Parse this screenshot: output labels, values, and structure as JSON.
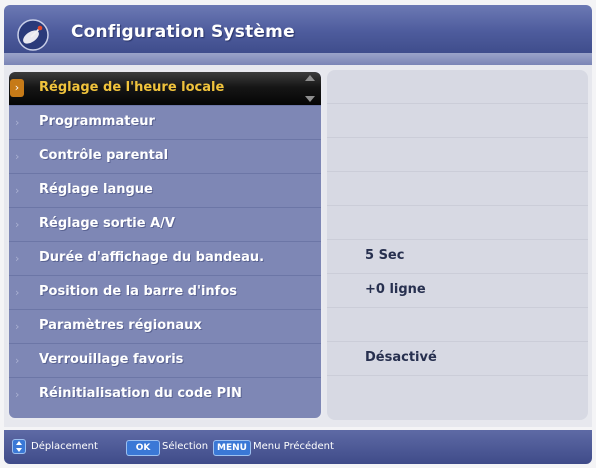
{
  "header": {
    "title": "Configuration Système",
    "logo_icon": "satellite-dish-icon"
  },
  "menu": {
    "selected_index": 0,
    "items": [
      {
        "label": "Réglage de l'heure locale",
        "value": ""
      },
      {
        "label": "Programmateur",
        "value": ""
      },
      {
        "label": "Contrôle parental",
        "value": ""
      },
      {
        "label": "Réglage langue",
        "value": ""
      },
      {
        "label": "Réglage sortie A/V",
        "value": ""
      },
      {
        "label": "Durée d'affichage du bandeau.",
        "value": "5 Sec"
      },
      {
        "label": "Position de la barre d'infos",
        "value": "+0 ligne"
      },
      {
        "label": "Paramètres régionaux",
        "value": ""
      },
      {
        "label": "Verrouillage favoris",
        "value": "Désactivé"
      },
      {
        "label": "Réinitialisation du code PIN",
        "value": ""
      }
    ]
  },
  "footer": {
    "nav_label": "Déplacement",
    "ok_key": "OK",
    "ok_label": "Sélection",
    "menu_key": "MENU",
    "menu_label": "Menu Précédent"
  },
  "colors": {
    "header": "#4e5c9d",
    "menu_panel": "#7e87b5",
    "selected_bg": "#000000",
    "selected_text": "#f0c33c",
    "value_panel": "#d7d9e3",
    "key_blue": "#3a78d6"
  }
}
